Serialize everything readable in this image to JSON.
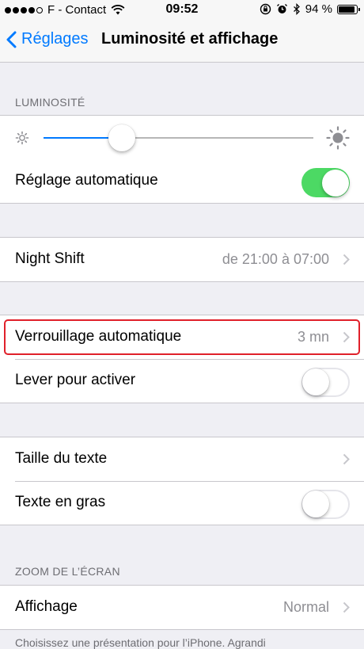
{
  "status_bar": {
    "carrier": "F - Contact",
    "signal_dots_filled": 4,
    "signal_dots_total": 5,
    "time": "09:52",
    "battery_percent": "94 %",
    "battery_level": 0.94
  },
  "nav": {
    "back_label": "Réglages",
    "title": "Luminosité et affichage"
  },
  "brightness": {
    "header": "LUMINOSITÉ",
    "level": 0.29,
    "auto_label": "Réglage automatique",
    "auto_on": true
  },
  "night_shift": {
    "label": "Night Shift",
    "value": "de 21:00 à 07:00"
  },
  "lock": {
    "auto_lock_label": "Verrouillage automatique",
    "auto_lock_value": "3 mn",
    "raise_label": "Lever pour activer",
    "raise_on": false
  },
  "text": {
    "size_label": "Taille du texte",
    "bold_label": "Texte en gras",
    "bold_on": false
  },
  "zoom": {
    "header": "ZOOM DE L’ÉCRAN",
    "display_label": "Affichage",
    "display_value": "Normal",
    "footer": "Choisissez une présentation pour l’iPhone. Agrandi"
  },
  "colors": {
    "accent": "#007aff",
    "toggle_on": "#4cd964",
    "highlight": "#e0202a"
  }
}
